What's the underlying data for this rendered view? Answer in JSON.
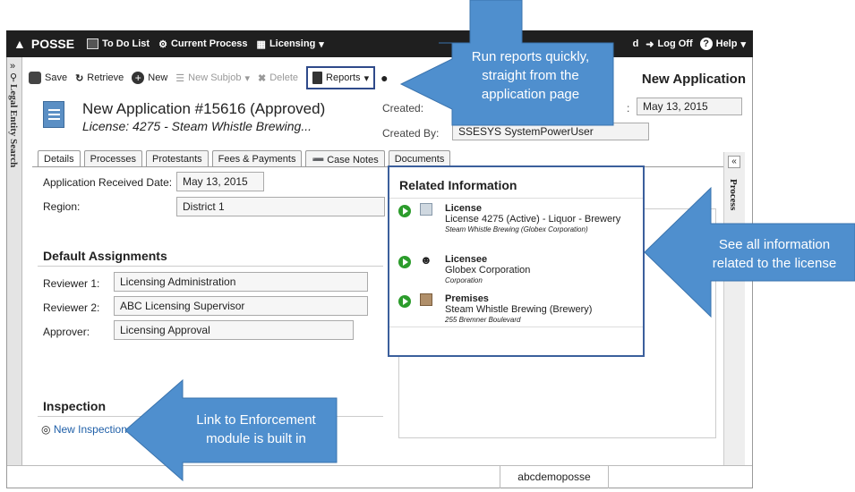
{
  "topbar": {
    "brand": "POSSE",
    "todo": "To Do List",
    "current_process": "Current Process",
    "licensing": "Licensing",
    "status_partial": "d",
    "logoff": "Log Off",
    "help": "Help"
  },
  "sidebar_left": {
    "label": "Legal Entity Search"
  },
  "toolbar": {
    "save": "Save",
    "retrieve": "Retrieve",
    "new": "New",
    "new_subjob": "New Subjob",
    "delete": "Delete",
    "reports": "Reports"
  },
  "header": {
    "page_title": "New Application",
    "title": "New Application #15616 (Approved)",
    "subtitle": "License: 4275 - Steam Whistle Brewing...",
    "created_label": "Created:",
    "created_by_label": "Created By:",
    "created_by_value": "SSESYS SystemPowerUser",
    "date_value": "May 13, 2015",
    "date_label_partial": ":"
  },
  "tabs": [
    "Details",
    "Processes",
    "Protestants",
    "Fees & Payments",
    "Case Notes",
    "Documents"
  ],
  "details": {
    "received_label": "Application Received Date:",
    "received_value": "May 13, 2015",
    "region_label": "Region:",
    "region_value": "District 1"
  },
  "assignments": {
    "heading": "Default Assignments",
    "reviewer1_label": "Reviewer 1:",
    "reviewer1_value": "Licensing Administration",
    "reviewer2_label": "Reviewer 2:",
    "reviewer2_value": "ABC Licensing Supervisor",
    "approver_label": "Approver:",
    "approver_value": "Licensing Approval"
  },
  "inspection": {
    "heading": "Inspection",
    "link": "New Inspection"
  },
  "related": {
    "heading": "Related Information",
    "items": [
      {
        "type": "License",
        "detail": "License 4275 (Active) - Liquor - Brewery",
        "sub": "Steam Whistle Brewing (Globex Corporation)"
      },
      {
        "type": "Licensee",
        "detail": "Globex Corporation",
        "sub": "Corporation"
      },
      {
        "type": "Premises",
        "detail": "Steam Whistle Brewing (Brewery)",
        "sub": "255 Bremner Boulevard"
      }
    ]
  },
  "sidebar_right": {
    "label": "Process",
    "collapse": "«"
  },
  "status": {
    "user": "abcdemoposse"
  },
  "callouts": {
    "reports": [
      "Run reports quickly,",
      "straight from the",
      "application page"
    ],
    "related": [
      "See all information",
      "related to the license"
    ],
    "enforcement": [
      "Link to Enforcement",
      "module is built in"
    ]
  },
  "colors": {
    "callout": "#4f8fce",
    "topbar": "#1f1f1f",
    "highlight": "#3b5f9c",
    "play": "#2c9c2c"
  }
}
